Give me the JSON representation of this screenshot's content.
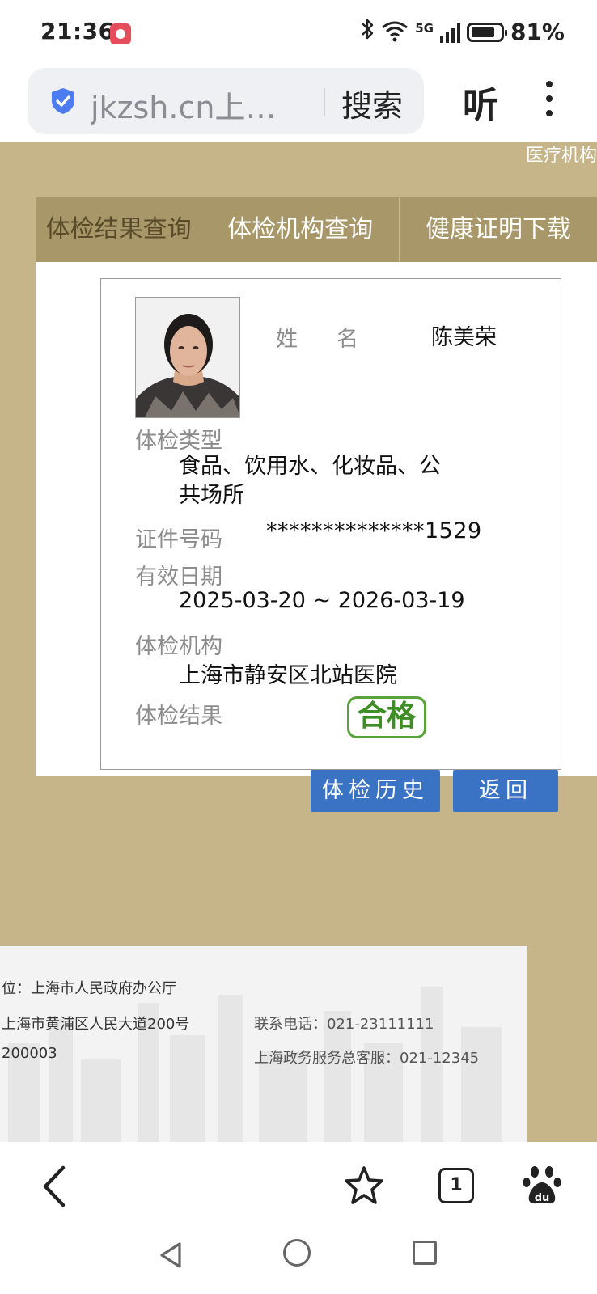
{
  "status_bar": {
    "time": "21:36",
    "network": "5G",
    "battery": "81%",
    "battery_level": 0.81,
    "icons": [
      "app-notification-icon",
      "bluetooth-icon",
      "wifi-icon",
      "signal-icon",
      "battery-icon"
    ]
  },
  "browser": {
    "url": "jkzsh.cn上海…",
    "search_label": "搜索",
    "listen_label": "听",
    "icons": [
      "shield-icon",
      "more-icon"
    ]
  },
  "page": {
    "top_link": "医疗机构",
    "tabs": [
      {
        "label": "体检结果查询"
      },
      {
        "label": "体检机构查询"
      },
      {
        "label": "健康证明下载"
      }
    ]
  },
  "record": {
    "name_label": "姓名",
    "name": "陈美荣",
    "exam_type_label": "体检类型",
    "exam_type": "食品、饮用水、化妆品、公共场所",
    "id_label": "证件号码",
    "id_number": "**************1529",
    "validity_label": "有效日期",
    "validity": "2025-03-20 ~ 2026-03-19",
    "institution_label": "体检机构",
    "institution": "上海市静安区北站医院",
    "result_label": "体检结果",
    "result": "合格"
  },
  "buttons": {
    "history": "体检历史",
    "back": "返回"
  },
  "footer": {
    "sponsor": "位：上海市人民政府办公厅",
    "address": "上海市黄浦区人民大道200号",
    "postcode": "200003",
    "phone": "联系电话：021-23111111",
    "hotline": "上海政务服务总客服：021-12345"
  },
  "bottom_bar": {
    "tab_count": "1",
    "icons": [
      "back-icon",
      "star-icon",
      "tabs-icon",
      "baidu-icon"
    ]
  },
  "nav": {
    "icons": [
      "nav-back-icon",
      "nav-home-icon",
      "nav-recents-icon"
    ]
  },
  "colors": {
    "page_bg": "#c6b589",
    "tab_bg": "#a89768",
    "button_blue": "#3a72c4",
    "pass_green": "#58a23a"
  }
}
